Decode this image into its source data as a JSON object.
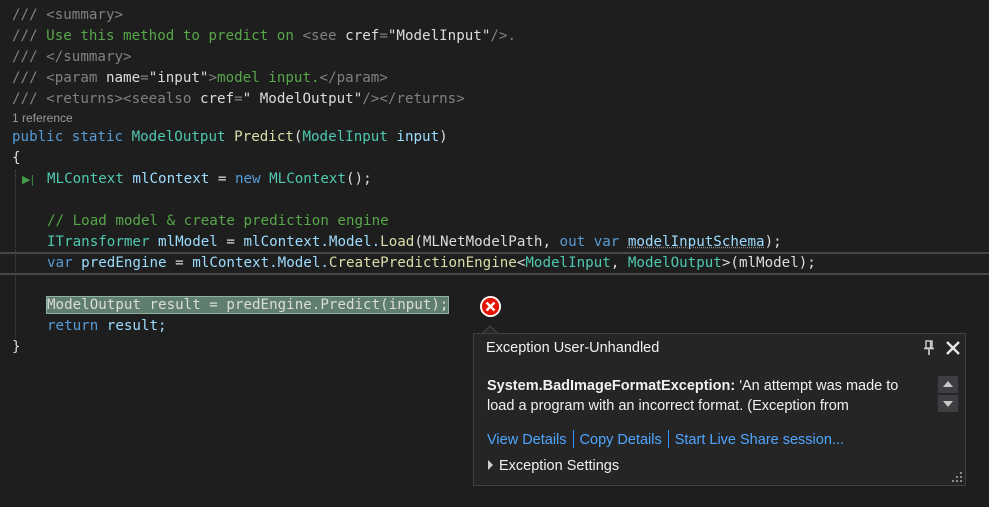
{
  "code": {
    "xmldoc_marker": "///",
    "summary_open": "<summary>",
    "summary_text": "Use this method to predict on",
    "see_open": "<see",
    "cref_attr": "cref",
    "eq": "=",
    "see_cref_value": "\"ModelInput\"",
    "see_close": "/>.",
    "summary_close": "</summary>",
    "param_open": "<param",
    "name_attr": "name",
    "param_name_value": "\"input\"",
    "param_gt": ">",
    "param_text": "model input.",
    "param_close": "</param>",
    "returns_open": "<returns><seealso",
    "seealso_cref_value": "\" ModelOutput\"",
    "returns_close": "/></returns>",
    "codelens_references": "1 reference",
    "kw_public": "public",
    "kw_static": "static",
    "type_model_output": "ModelOutput",
    "method_predict": "Predict",
    "open_paren": "(",
    "type_model_input": "ModelInput",
    "param_input": "input",
    "close_paren": ")",
    "brace_open": "{",
    "type_mlcontext": "MLContext",
    "var_mlcontext": "mlContext",
    "assign": "=",
    "kw_new": "new",
    "ctor_tail": "();",
    "comment_load": "// Load model & create prediction engine",
    "type_itransformer": "ITransformer",
    "var_mlmodel": "mlModel",
    "member_model": "mlContext.Model.",
    "method_load": "Load",
    "load_arg": "(MLNetModelPath,",
    "kw_out": "out",
    "kw_var": "var",
    "var_schema": "modelInputSchema",
    "end_stmt": ");",
    "var_predengine": "predEngine",
    "method_create_engine": "CreatePredictionEngine",
    "lt": "<",
    "comma": ",",
    "gt_args": ">(mlModel);",
    "exec_line": "ModelOutput result = predEngine.Predict(input);",
    "kw_return": "return",
    "return_tail": "result;",
    "brace_close": "}",
    "step_marker_glyph": "▶|"
  },
  "exception_popup": {
    "title": "Exception User-Unhandled",
    "exception_type": "System.BadImageFormatException:",
    "message": " 'An attempt was made to load a program with an incorrect format. (Exception from",
    "links": {
      "view_details": "View Details",
      "copy_details": "Copy Details",
      "live_share": "Start Live Share session..."
    },
    "settings_label": "Exception Settings"
  },
  "colors": {
    "background": "#1e1e1e",
    "comment": "#57a64a",
    "keyword": "#569cd6",
    "type": "#4ec9b0",
    "method": "#dcdcaa",
    "string": "#d69d85",
    "error": "#e51400",
    "link": "#3794ff"
  },
  "icons": {
    "error": "error-icon",
    "pin": "pin-icon",
    "close": "close-icon",
    "scroll_up": "chevron-up-icon",
    "scroll_down": "chevron-down-icon",
    "grip": "resize-grip-icon"
  }
}
